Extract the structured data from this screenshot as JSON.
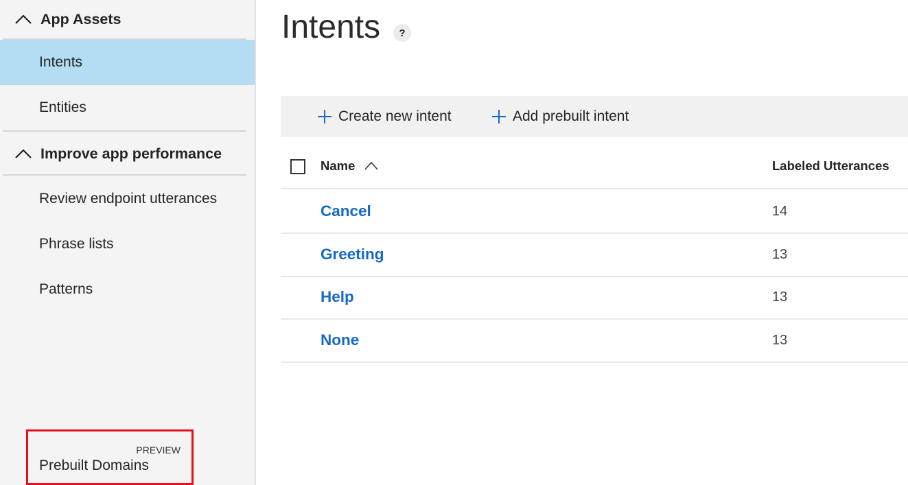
{
  "sidebar": {
    "app_assets": {
      "label": "App Assets",
      "icon": "chevron-up-icon"
    },
    "items_assets": [
      {
        "label": "Intents",
        "active": true
      },
      {
        "label": "Entities",
        "active": false
      }
    ],
    "improve": {
      "label": "Improve app performance",
      "icon": "chevron-up-icon"
    },
    "items_improve": [
      {
        "label": "Review endpoint utterances"
      },
      {
        "label": "Phrase lists"
      },
      {
        "label": "Patterns"
      }
    ],
    "prebuilt_domains": {
      "label": "Prebuilt Domains",
      "badge": "PREVIEW",
      "highlight_color": "#e3101e"
    }
  },
  "main": {
    "title": "Intents",
    "help_label": "?",
    "toolbar": {
      "create_label": "Create new intent",
      "prebuilt_label": "Add prebuilt intent",
      "plus_icon": "plus-icon",
      "accent": "#1769c7"
    },
    "table": {
      "col_name": "Name",
      "col_utterances": "Labeled Utterances",
      "sort_icon": "sort-ascending-icon",
      "rows": [
        {
          "name": "Cancel",
          "count": "14"
        },
        {
          "name": "Greeting",
          "count": "13"
        },
        {
          "name": "Help",
          "count": "13"
        },
        {
          "name": "None",
          "count": "13"
        }
      ]
    }
  }
}
